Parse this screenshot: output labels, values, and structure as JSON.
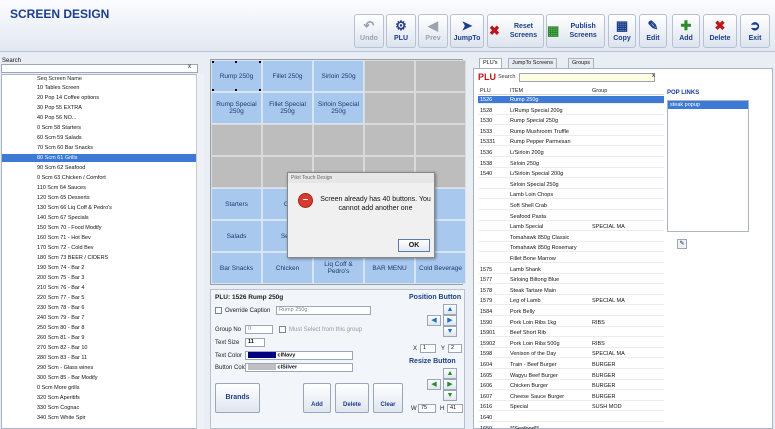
{
  "app_title": "SCREEN DESIGN",
  "toolbar": {
    "undo": "Undo",
    "plu": "PLU",
    "prev": "Prev",
    "jumpto": "JumpTo",
    "reset": "Reset Screens",
    "publish": "Publish Screens",
    "copy": "Copy",
    "edit": "Edit",
    "add": "Add",
    "delete": "Delete",
    "exit": "Exit"
  },
  "left": {
    "search_label": "Search",
    "search_clear": "x",
    "header": "Seq Screen Name",
    "items": [
      "10 Tables Screen",
      "20 Pop 14 Coffee options",
      "30 Pop 55 EXTRA",
      "40 Pop 56 NO...",
      "0 Scm 58 Starters",
      "60 Scm 59 Salads",
      "70 Scm 60 Bar Snacks",
      "80 Scm 61 Grills",
      "90 Scm 62 Seafood",
      "0 Scm 63 Chicken / Comfort",
      "110 Scm 64 Sauces",
      "120 Scm 65 Desserts",
      "130 Scm 66 Liq Coff & Pedro's",
      "140 Scm 67 Specials",
      "150 Scm 70 - Food Modify",
      "160 Scm 71 - Hot Bev",
      "170 Scm 72 - Cold Bev",
      "180 Scm 73 BEER / CIDERS",
      "190 Scm 74 - Bar 2",
      "200 Scm 75 - Bar 3",
      "210 Scm 76 - Bar 4",
      "220 Scm 77 - Bar 5",
      "230 Scm 78 - Bar 6",
      "240 Scm 79 - Bar 7",
      "250 Scm 80 - Bar 8",
      "260 Scm 81 - Bar 9",
      "270 Scm 82 - Bar 10",
      "280 Scm 83 - Bar 11",
      "290 Scm - Glass wines",
      "300 Scm 85 - Bar Modify",
      "0 Scm More grills",
      "320 Scm Aperitifs",
      "330 Scm Cognac",
      "340 Scm White Spir"
    ],
    "selected_index": 7
  },
  "grid": {
    "buttons": [
      {
        "row": 0,
        "col": 0,
        "label": "Rump 250g",
        "style": "blue"
      },
      {
        "row": 0,
        "col": 1,
        "label": "Fillet 250g",
        "style": "blue"
      },
      {
        "row": 0,
        "col": 2,
        "label": "Sirloin 250g",
        "style": "blue"
      },
      {
        "row": 1,
        "col": 0,
        "label": "Rump Special 250g",
        "style": "blue"
      },
      {
        "row": 1,
        "col": 1,
        "label": "Fillet Special 250g",
        "style": "blue"
      },
      {
        "row": 1,
        "col": 2,
        "label": "Sirloin Special 250g",
        "style": "blue"
      },
      {
        "row": 4,
        "col": 0,
        "label": "Starters",
        "style": "blue"
      },
      {
        "row": 4,
        "col": 1,
        "label": "Gr",
        "style": "blue"
      },
      {
        "row": 5,
        "col": 0,
        "label": "Salads",
        "style": "blue"
      },
      {
        "row": 5,
        "col": 1,
        "label": "Seaf",
        "style": "blue"
      },
      {
        "row": 6,
        "col": 0,
        "label": "Bar Snacks",
        "style": "blue"
      },
      {
        "row": 6,
        "col": 1,
        "label": "Chicken",
        "style": "blue"
      },
      {
        "row": 6,
        "col": 2,
        "label": "Liq Coff & Pedro's",
        "style": "blue"
      },
      {
        "row": 6,
        "col": 3,
        "label": "BAR MENU",
        "style": "blue"
      },
      {
        "row": 6,
        "col": 4,
        "label": "Cold Beverage",
        "style": "blue"
      },
      {
        "row": 4,
        "col": 3,
        "label": "",
        "style": "blue"
      },
      {
        "row": 4,
        "col": 4,
        "label": "",
        "style": "blue"
      },
      {
        "row": 5,
        "col": 3,
        "label": "",
        "style": "blue"
      },
      {
        "row": 5,
        "col": 4,
        "label": "",
        "style": "blue"
      }
    ]
  },
  "props": {
    "plu_label": "PLU: 1526 Rump 250g",
    "override_caption": "Override Caption",
    "caption_value": "Rump 250g",
    "group_no": "Group No",
    "group_value": "0",
    "must_select": "Must Select from this group",
    "text_size": "Text Size",
    "text_size_value": "11",
    "text_color": "Text Color",
    "text_color_value": "clNavy",
    "text_color_hex": "#000080",
    "button_color": "Button Color",
    "button_color_value": "clSilver",
    "button_color_hex": "#c0c0c0",
    "brands": "Brands",
    "add": "Add",
    "delete": "Delete",
    "clear": "Clear",
    "position_title": "Position Button",
    "x_label": "X",
    "x_value": "1",
    "y_label": "Y",
    "y_value": "2",
    "resize_title": "Resize Button",
    "w_label": "W",
    "w_value": "75",
    "h_label": "H",
    "h_value": "41"
  },
  "dialog": {
    "title": "Pilot Touch Design",
    "message": "Screen  already has 40 buttons. You cannot add another one",
    "ok": "OK"
  },
  "right": {
    "tabs": [
      "PLU's",
      "JumpTo Screens",
      "Groups"
    ],
    "plu_title": "PLU",
    "search_label": "Search",
    "search_clear": "x",
    "columns": [
      "PLU",
      "ITEM",
      "Group"
    ],
    "rows": [
      [
        "1526",
        "Rump 250g",
        ""
      ],
      [
        "1528",
        "L/Rump Special 200g",
        ""
      ],
      [
        "1530",
        "Rump Special 250g",
        ""
      ],
      [
        "1533",
        "Rump Mushroom Truffle",
        ""
      ],
      [
        "15331",
        "Rump Pepper Parmesan",
        ""
      ],
      [
        "1536",
        "L/Sirloin 200g",
        ""
      ],
      [
        "1538",
        "Sirloin 250g",
        ""
      ],
      [
        "1540",
        "L/Sirloin Special 200g",
        ""
      ],
      [
        "",
        "Sirloin Special 250g",
        ""
      ],
      [
        "",
        "Lamb Loin Chops",
        ""
      ],
      [
        "",
        "Soft Shell Crab",
        ""
      ],
      [
        "",
        "Seafood Pasta",
        ""
      ],
      [
        "",
        "Lamb Special",
        "SPECIAL MA"
      ],
      [
        "",
        "Tomahawk 850g Classic",
        ""
      ],
      [
        "",
        "Tomahawk 850g Rosemary",
        ""
      ],
      [
        "",
        "Fillet Bone Marrow",
        ""
      ],
      [
        "1575",
        "Lamb Shank",
        ""
      ],
      [
        "1577",
        "Sirloing Biltong Blue",
        ""
      ],
      [
        "1578",
        "Steak Tartare Main",
        ""
      ],
      [
        "1579",
        "Leg of Lamb",
        "SPECIAL MA"
      ],
      [
        "1584",
        "Pork Belly",
        ""
      ],
      [
        "1590",
        "Pork Loin Ribs 1kg",
        "RIBS"
      ],
      [
        "15901",
        "Beef Short Rib",
        ""
      ],
      [
        "15902",
        "Pork Loin Ribs 500g",
        "RIBS"
      ],
      [
        "1598",
        "Venison of the Day",
        "SPECIAL MA"
      ],
      [
        "1604",
        "Train - Beef Burger",
        "BURGER"
      ],
      [
        "1605",
        "Wagyu Beef Burger",
        "BURGER"
      ],
      [
        "1606",
        "Chicken Burger",
        "BURGER"
      ],
      [
        "1607",
        "Cheese Sauce Burger",
        "BURGER"
      ],
      [
        "1616",
        "Special",
        "SUSH MOD"
      ],
      [
        "1640",
        "",
        ""
      ],
      [
        "1650",
        "**Seafood**",
        ""
      ]
    ],
    "selected_index": 0,
    "pop_links_title": "POP LINKS",
    "pop_item": "steak popup"
  },
  "colors": {
    "accent": "#1c3e8c",
    "selection": "#3d7ad6",
    "grid_button": "#a9c8ee",
    "error": "#d63b2e"
  }
}
